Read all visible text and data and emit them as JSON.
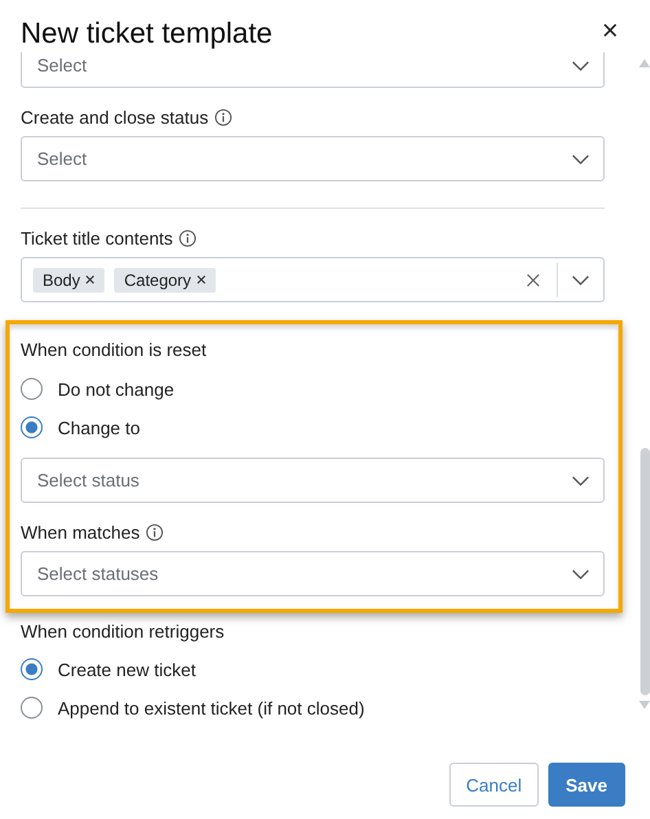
{
  "dialog": {
    "title": "New ticket template"
  },
  "sections": [
    {
      "kind": "select",
      "placeholder": "Select"
    },
    {
      "kind": "select",
      "label": "Create and close status",
      "info": true,
      "placeholder": "Select"
    },
    {
      "kind": "divider"
    },
    {
      "kind": "multiselect",
      "label": "Ticket title contents",
      "info": true,
      "tags": [
        "Body",
        "Category"
      ]
    },
    {
      "kind": "frame",
      "items": [
        {
          "kind": "radios",
          "label": "When condition is reset",
          "options": [
            {
              "label": "Do not change",
              "selected": false
            },
            {
              "label": "Change to",
              "selected": true
            }
          ]
        },
        {
          "kind": "select",
          "placeholder": "Select status"
        },
        {
          "kind": "select",
          "label": "When matches",
          "info": true,
          "placeholder": "Select statuses"
        }
      ]
    },
    {
      "kind": "radios",
      "label": "When condition retriggers",
      "options": [
        {
          "label": "Create new ticket",
          "selected": true
        },
        {
          "label": "Append to existent ticket (if not closed)",
          "selected": false
        }
      ]
    }
  ],
  "buttons": [
    {
      "label": "Cancel",
      "kind": "secondary"
    },
    {
      "label": "Save",
      "kind": "primary"
    }
  ]
}
